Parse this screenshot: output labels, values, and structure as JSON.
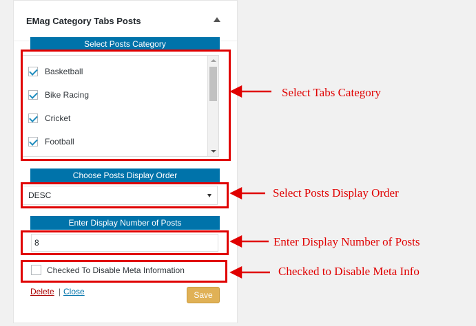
{
  "widget": {
    "title": "EMag Category Tabs Posts"
  },
  "category_section": {
    "label": "Select Posts Category",
    "items": [
      {
        "label": "Basketball",
        "checked": true
      },
      {
        "label": "Bike Racing",
        "checked": true
      },
      {
        "label": "Cricket",
        "checked": true
      },
      {
        "label": "Football",
        "checked": true
      }
    ]
  },
  "order_section": {
    "label": "Choose Posts Display Order",
    "selected": "DESC"
  },
  "number_section": {
    "label": "Enter Display Number of Posts",
    "value": "8"
  },
  "meta_option": {
    "label": "Checked To Disable Meta Information",
    "checked": false
  },
  "actions": {
    "delete_label": "Delete",
    "separator": "|",
    "close_label": "Close",
    "save_label": "Save"
  },
  "annotations": {
    "tabs_category": "Select Tabs Category",
    "display_order": "Select Posts Display Order",
    "display_number": "Enter Display Number of Posts",
    "disable_meta": "Checked to Disable Meta Info"
  },
  "colors": {
    "accent_blue": "#0073aa",
    "save_button": "#e0b156",
    "annotation_red": "#e00000"
  },
  "icons": {
    "collapse": "triangle-up-icon",
    "checkbox_checked": "checkmark-icon",
    "select_caret": "caret-down-icon",
    "arrow": "arrow-left-icon"
  }
}
